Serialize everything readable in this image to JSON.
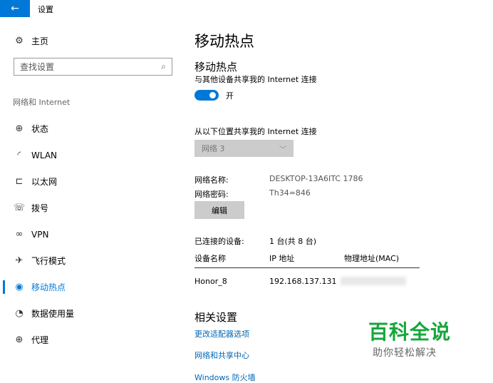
{
  "window": {
    "title": "设置",
    "back_icon": "back-arrow-icon"
  },
  "sidebar": {
    "home_label": "主页",
    "search_placeholder": "查找设置",
    "section": "网络和 Internet",
    "items": [
      {
        "label": "状态",
        "icon": "globe-status-icon",
        "active": false
      },
      {
        "label": "WLAN",
        "icon": "wifi-icon",
        "active": false
      },
      {
        "label": "以太网",
        "icon": "ethernet-icon",
        "active": false
      },
      {
        "label": "拨号",
        "icon": "dialup-icon",
        "active": false
      },
      {
        "label": "VPN",
        "icon": "vpn-icon",
        "active": false
      },
      {
        "label": "飞行模式",
        "icon": "airplane-icon",
        "active": false
      },
      {
        "label": "移动热点",
        "icon": "hotspot-icon",
        "active": true
      },
      {
        "label": "数据使用量",
        "icon": "data-usage-icon",
        "active": false
      },
      {
        "label": "代理",
        "icon": "proxy-globe-icon",
        "active": false
      }
    ]
  },
  "main": {
    "page_title": "移动热点",
    "sub_title": "移动热点",
    "share_desc": "与其他设备共享我的 Internet 连接",
    "toggle_state": "开",
    "from_label": "从以下位置共享我的 Internet 连接",
    "select_value": "网络 3",
    "network_name_label": "网络名称:",
    "network_name_value": "DESKTOP-13A6ITC 1786",
    "network_password_label": "网络密码:",
    "network_password_value": "Th34=846",
    "edit_button": "编辑",
    "connected_label": "已连接的设备:",
    "connected_value": "1 台(共 8 台)",
    "table": {
      "headers": [
        "设备名称",
        "IP 地址",
        "物理地址(MAC)"
      ],
      "rows": [
        {
          "name": "Honor_8",
          "ip": "192.168.137.131"
        }
      ]
    },
    "related_title": "相关设置",
    "links": [
      "更改适配器选项",
      "网络和共享中心",
      "Windows 防火墙"
    ]
  },
  "watermark": {
    "main": "百科全说",
    "sub": "助你轻松解决"
  },
  "colors": {
    "accent": "#0078d7",
    "link": "#0066b4",
    "watermark": "#15a63b"
  }
}
